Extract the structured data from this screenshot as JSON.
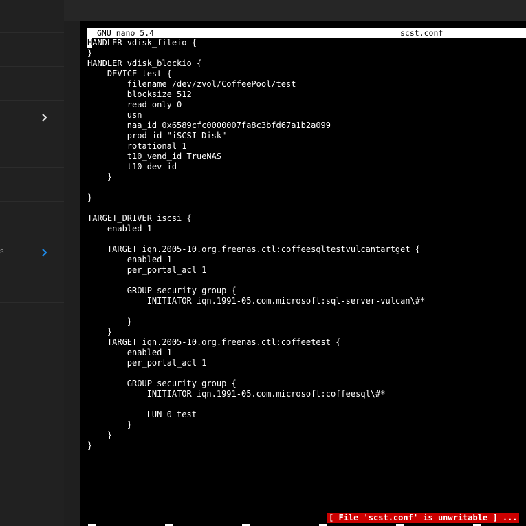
{
  "sidebar": {
    "items": [
      {
        "label": "",
        "chevron": false
      },
      {
        "label": "",
        "chevron": false
      },
      {
        "label": "",
        "chevron": false
      },
      {
        "label": "",
        "chevron": true,
        "chevron_color": "#e0e0e0"
      },
      {
        "label": "",
        "chevron": false
      },
      {
        "label": "",
        "chevron": false
      },
      {
        "label": "",
        "chevron": false
      },
      {
        "label": "s",
        "chevron": true,
        "chevron_color": "#1e88e5"
      },
      {
        "label": "",
        "chevron": false
      }
    ]
  },
  "terminal": {
    "nano_version": "GNU nano 5.4",
    "filename": "scst.conf",
    "cursor_char": "H",
    "lines": [
      "ANDLER vdisk_fileio {",
      "}",
      "HANDLER vdisk_blockio {",
      "    DEVICE test {",
      "        filename /dev/zvol/CoffeePool/test",
      "        blocksize 512",
      "        read_only 0",
      "        usn",
      "        naa_id 0x6589cfc0000007fa8c3bfd67a1b2a099",
      "        prod_id \"iSCSI Disk\"",
      "        rotational 1",
      "        t10_vend_id TrueNAS",
      "        t10_dev_id",
      "    }",
      "",
      "}",
      "",
      "TARGET_DRIVER iscsi {",
      "    enabled 1",
      "",
      "    TARGET iqn.2005-10.org.freenas.ctl:coffeesqltestvulcantartget {",
      "        enabled 1",
      "        per_portal_acl 1",
      "",
      "        GROUP security_group {",
      "            INITIATOR iqn.1991-05.com.microsoft:sql-server-vulcan\\#*",
      "",
      "        }",
      "    }",
      "    TARGET iqn.2005-10.org.freenas.ctl:coffeetest {",
      "        enabled 1",
      "        per_portal_acl 1",
      "",
      "        GROUP security_group {",
      "            INITIATOR iqn.1991-05.com.microsoft:coffeesql\\#*",
      "",
      "            LUN 0 test",
      "        }",
      "    }",
      "}"
    ],
    "status_message": "[ File 'scst.conf' is unwritable ] ...",
    "status_color": "#cc0000"
  }
}
